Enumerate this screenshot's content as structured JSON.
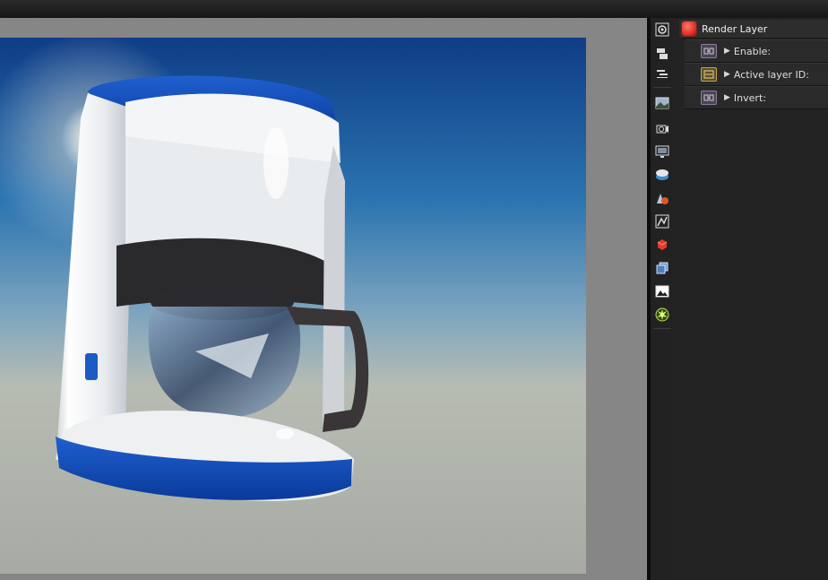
{
  "viewport": {
    "render_image": "coffee-maker-render"
  },
  "toolbar": {
    "tools": [
      {
        "name": "render-settings-icon"
      },
      {
        "name": "layers-icon"
      },
      {
        "name": "pipeline-icon"
      },
      {
        "name": "image-preview-icon"
      },
      {
        "name": "camera-icon"
      },
      {
        "name": "display-icon"
      },
      {
        "name": "environment-icon"
      },
      {
        "name": "material-icon"
      },
      {
        "name": "texture-icon"
      },
      {
        "name": "render-layer-icon"
      },
      {
        "name": "cube-stack-icon"
      },
      {
        "name": "image-icon"
      },
      {
        "name": "light-icon"
      }
    ]
  },
  "panel": {
    "title": "Render Layer",
    "params": [
      {
        "label": "Enable:",
        "type": "bool"
      },
      {
        "label": "Active layer ID:",
        "type": "int"
      },
      {
        "label": "Invert:",
        "type": "bool"
      }
    ]
  },
  "colors": {
    "accent_red": "#d8261b",
    "bool_button": "#8a7e96",
    "int_button": "#c9a24a",
    "viewport_bg": "#868686"
  }
}
